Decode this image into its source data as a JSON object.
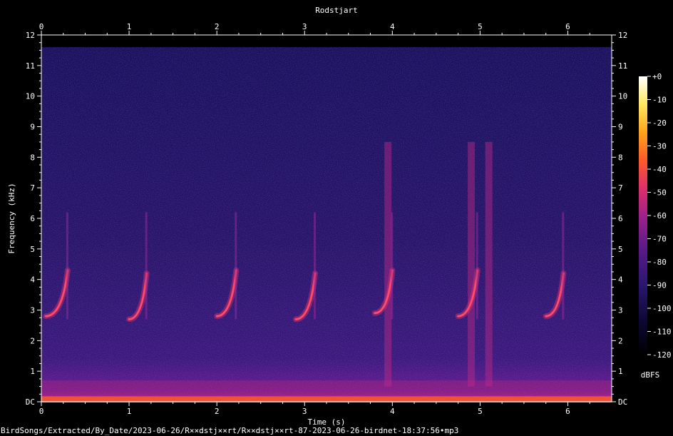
{
  "chart_data": {
    "type": "heatmap",
    "title": "Rodstjart",
    "xlabel": "Time (s)",
    "ylabel": "Frequency (kHz)",
    "x_ticks": [
      "0",
      "1",
      "2",
      "3",
      "4",
      "5",
      "6"
    ],
    "y_ticks": [
      "DC",
      "1",
      "2",
      "3",
      "4",
      "5",
      "6",
      "7",
      "8",
      "9",
      "10",
      "11",
      "12"
    ],
    "xlim": [
      0,
      6.5
    ],
    "ylim": [
      0,
      12
    ],
    "colorbar": {
      "label": "dBFS",
      "ticks": [
        "+0",
        "-10",
        "-20",
        "-30",
        "-40",
        "-50",
        "-60",
        "-70",
        "-80",
        "-90",
        "-100",
        "-110",
        "-120"
      ],
      "range": [
        -120,
        0
      ]
    },
    "colormap": [
      "#000000",
      "#0c0834",
      "#2b1670",
      "#5a1a8a",
      "#a0218a",
      "#e0306a",
      "#ff5a2a",
      "#ffa51a",
      "#ffe860",
      "#ffffff"
    ],
    "calls": [
      {
        "t_start": 0.05,
        "t_end": 0.3,
        "f_low_khz": 2.8,
        "f_high_khz": 4.3
      },
      {
        "t_start": 1.0,
        "t_end": 1.2,
        "f_low_khz": 2.7,
        "f_high_khz": 4.2
      },
      {
        "t_start": 2.0,
        "t_end": 2.22,
        "f_low_khz": 2.8,
        "f_high_khz": 4.3
      },
      {
        "t_start": 2.9,
        "t_end": 3.12,
        "f_low_khz": 2.7,
        "f_high_khz": 4.2
      },
      {
        "t_start": 3.8,
        "t_end": 4.0,
        "f_low_khz": 2.9,
        "f_high_khz": 4.3
      },
      {
        "t_start": 4.75,
        "t_end": 4.97,
        "f_low_khz": 2.8,
        "f_high_khz": 4.3
      },
      {
        "t_start": 5.75,
        "t_end": 5.95,
        "f_low_khz": 2.8,
        "f_high_khz": 4.2
      }
    ],
    "broadband_bursts_s": [
      3.95,
      4.9,
      5.1
    ]
  },
  "footer_text": "BirdSongs/Extracted/By_Date/2023-06-26/R××dstj××rt/R××dstj××rt-87-2023-06-26-birdnet-18:37:56•mp3"
}
